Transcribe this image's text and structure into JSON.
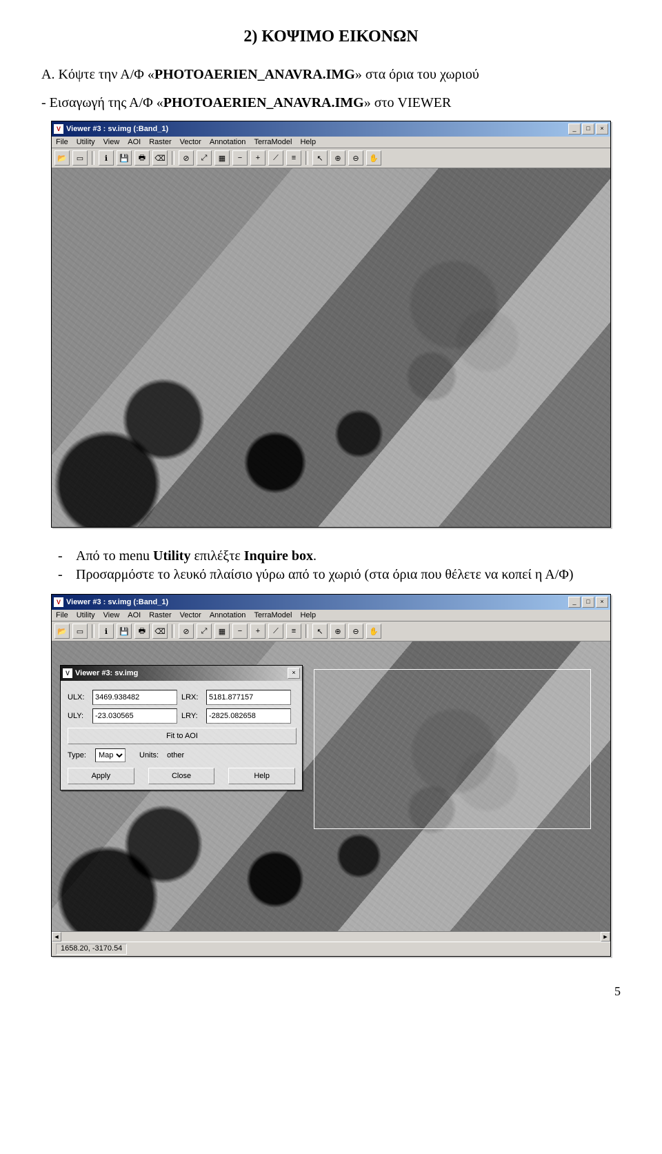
{
  "heading": "2) ΚΟΨΙΜΟ ΕΙΚΟΝΩΝ",
  "section_a_prefix": "A. Κόψτε την Α/Φ «",
  "section_a_bold": "PHOTOAERIEN_ANAVRA.IMG",
  "section_a_suffix": "» στα όρια του χωριού",
  "intro_prefix": "- Εισαγωγή της Α/Φ «",
  "intro_bold": "PHOTOAERIEN_ANAVRA.IMG",
  "intro_suffix": "» στο VIEWER",
  "bullets": [
    {
      "prefix": "Από το menu ",
      "bold1": "Utility",
      "mid": " επιλέξτε ",
      "bold2": "Inquire box",
      "suffix": "."
    },
    {
      "text": "Προσαρμόστε το λευκό πλαίσιο γύρω από το χωριό (στα όρια που θέλετε να κοπεί η Α/Φ)"
    }
  ],
  "page_number": "5",
  "viewer": {
    "title": "Viewer #3 : sv.img (:Band_1)",
    "menus": [
      "File",
      "Utility",
      "View",
      "AOI",
      "Raster",
      "Vector",
      "Annotation",
      "TerraModel",
      "Help"
    ],
    "winbtns": {
      "min": "_",
      "max": "□",
      "close": "×"
    },
    "toolbar_icons": [
      "open-icon",
      "new-icon",
      "info-icon",
      "save-icon",
      "print-icon",
      "erase-icon",
      "stop-icon",
      "fit-icon",
      "extent-icon",
      "zoom-out-line-icon",
      "plus-icon",
      "measure-icon",
      "ruler-icon",
      "pointer-icon",
      "zoom-in-icon",
      "zoom-out-icon",
      "pan-icon"
    ],
    "toolbar_glyphs": {
      "open-icon": "📂",
      "new-icon": "▭",
      "info-icon": "ℹ",
      "save-icon": "💾",
      "print-icon": "🖶",
      "erase-icon": "⌫",
      "stop-icon": "⊘",
      "fit-icon": "⤢",
      "extent-icon": "▦",
      "zoom-out-line-icon": "−",
      "plus-icon": "+",
      "measure-icon": "⟋",
      "ruler-icon": "≡",
      "pointer-icon": "↖",
      "zoom-in-icon": "⊕",
      "zoom-out-icon": "⊖",
      "pan-icon": "✋"
    },
    "status": "1658.20, -3170.54"
  },
  "dialog": {
    "title": "Viewer #3: sv.img",
    "close": "×",
    "ulx_label": "ULX:",
    "ulx_value": "3469.938482",
    "lrx_label": "LRX:",
    "lrx_value": "5181.877157",
    "uly_label": "ULY:",
    "uly_value": "-23.030565",
    "lry_label": "LRY:",
    "lry_value": "-2825.082658",
    "fit_btn": "Fit to AOI",
    "type_label": "Type:",
    "type_value": "Map",
    "units_label": "Units:",
    "units_value": "other",
    "apply": "Apply",
    "close_btn": "Close",
    "help": "Help"
  }
}
